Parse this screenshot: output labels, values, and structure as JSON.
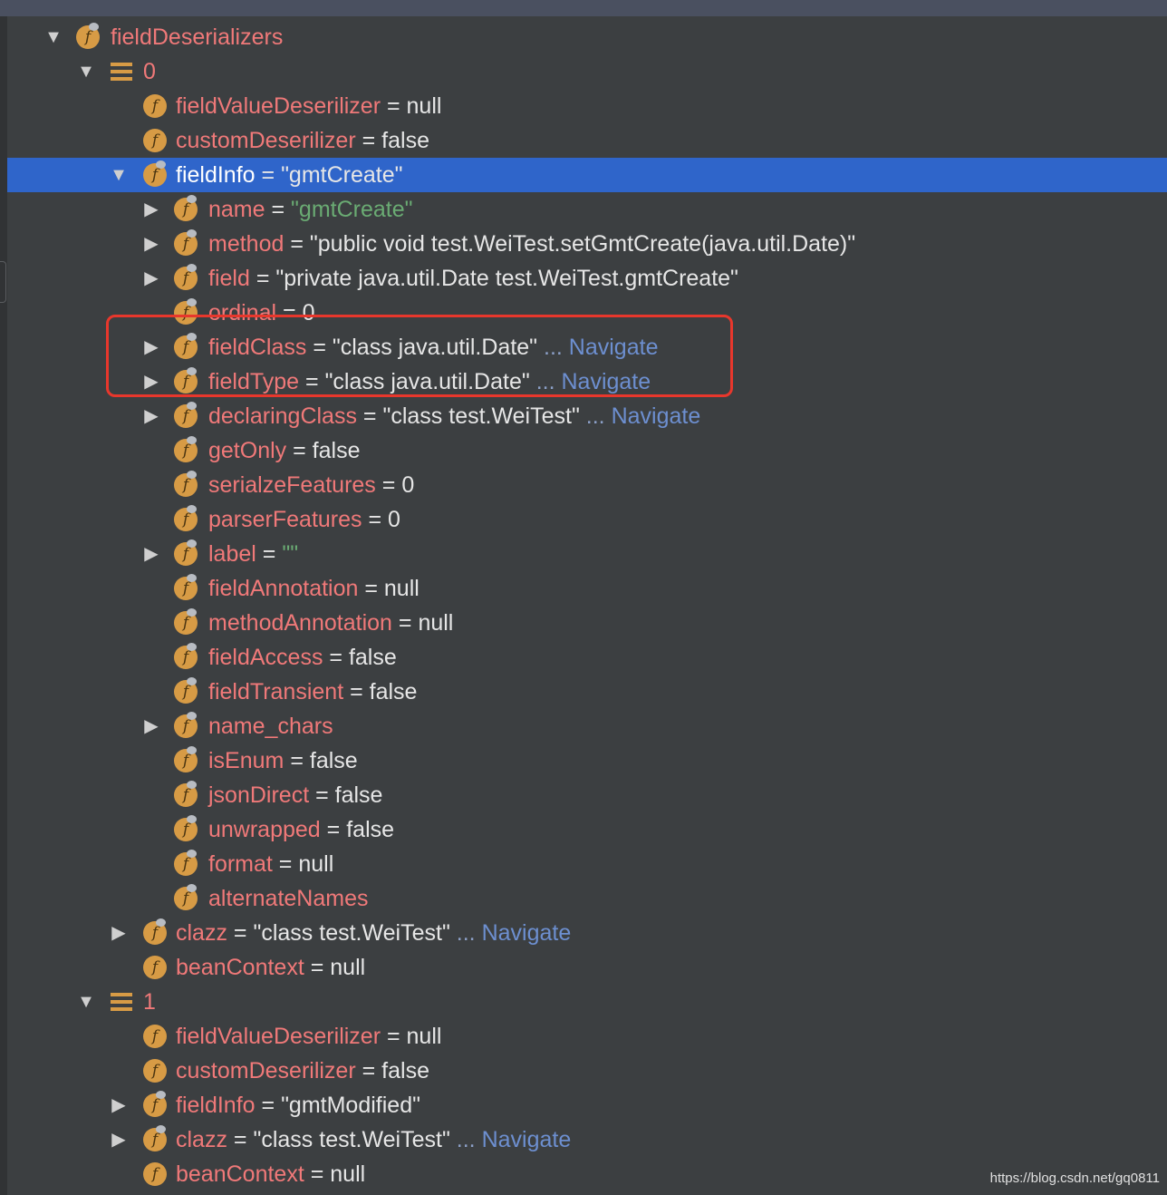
{
  "rows": [
    {
      "depth": 0,
      "arrow": "expanded",
      "icon": "f-lock",
      "name": "fieldDeserializers",
      "eq": "",
      "value": "",
      "vtype": "",
      "navigate": ""
    },
    {
      "depth": 1,
      "arrow": "expanded",
      "icon": "list",
      "name": "0",
      "eq": "",
      "value": "",
      "vtype": "",
      "navigate": ""
    },
    {
      "depth": 2,
      "arrow": "",
      "icon": "f",
      "name": "fieldValueDeserilizer",
      "eq": " = ",
      "value": "null",
      "vtype": "kw",
      "navigate": ""
    },
    {
      "depth": 2,
      "arrow": "",
      "icon": "f",
      "name": "customDeserilizer",
      "eq": " = ",
      "value": "false",
      "vtype": "kw",
      "navigate": ""
    },
    {
      "depth": 2,
      "arrow": "expanded",
      "icon": "f-lock",
      "name": "fieldInfo",
      "eq": " = ",
      "value": "\"gmtCreate\"",
      "vtype": "str",
      "navigate": "",
      "selected": true
    },
    {
      "depth": 3,
      "arrow": "collapsed",
      "icon": "f-lock",
      "name": "name",
      "eq": " = ",
      "value": "\"gmtCreate\"",
      "vtype": "str green",
      "navigate": ""
    },
    {
      "depth": 3,
      "arrow": "collapsed",
      "icon": "f-lock",
      "name": "method",
      "eq": " = ",
      "value": "\"public void test.WeiTest.setGmtCreate(java.util.Date)\"",
      "vtype": "str",
      "navigate": ""
    },
    {
      "depth": 3,
      "arrow": "collapsed",
      "icon": "f-lock",
      "name": "field",
      "eq": " = ",
      "value": "\"private java.util.Date test.WeiTest.gmtCreate\"",
      "vtype": "str",
      "navigate": ""
    },
    {
      "depth": 3,
      "arrow": "",
      "icon": "f-lock",
      "name": "ordinal",
      "eq": " = ",
      "value": "0",
      "vtype": "kw",
      "navigate": ""
    },
    {
      "depth": 3,
      "arrow": "collapsed",
      "icon": "f-lock",
      "name": "fieldClass",
      "eq": " = ",
      "value": "\"class java.util.Date\"",
      "vtype": "str",
      "navigate": "Navigate"
    },
    {
      "depth": 3,
      "arrow": "collapsed",
      "icon": "f-lock",
      "name": "fieldType",
      "eq": " = ",
      "value": "\"class java.util.Date\"",
      "vtype": "str",
      "navigate": "Navigate"
    },
    {
      "depth": 3,
      "arrow": "collapsed",
      "icon": "f-lock",
      "name": "declaringClass",
      "eq": " = ",
      "value": "\"class test.WeiTest\"",
      "vtype": "str",
      "navigate": "Navigate"
    },
    {
      "depth": 3,
      "arrow": "",
      "icon": "f-lock",
      "name": "getOnly",
      "eq": " = ",
      "value": "false",
      "vtype": "kw",
      "navigate": ""
    },
    {
      "depth": 3,
      "arrow": "",
      "icon": "f-lock",
      "name": "serialzeFeatures",
      "eq": " = ",
      "value": "0",
      "vtype": "kw",
      "navigate": ""
    },
    {
      "depth": 3,
      "arrow": "",
      "icon": "f-lock",
      "name": "parserFeatures",
      "eq": " = ",
      "value": "0",
      "vtype": "kw",
      "navigate": ""
    },
    {
      "depth": 3,
      "arrow": "collapsed",
      "icon": "f-lock",
      "name": "label",
      "eq": " = ",
      "value": "\"\"",
      "vtype": "str green",
      "navigate": ""
    },
    {
      "depth": 3,
      "arrow": "",
      "icon": "f-lock",
      "name": "fieldAnnotation",
      "eq": " = ",
      "value": "null",
      "vtype": "kw",
      "navigate": ""
    },
    {
      "depth": 3,
      "arrow": "",
      "icon": "f-lock",
      "name": "methodAnnotation",
      "eq": " = ",
      "value": "null",
      "vtype": "kw",
      "navigate": ""
    },
    {
      "depth": 3,
      "arrow": "",
      "icon": "f-lock",
      "name": "fieldAccess",
      "eq": " = ",
      "value": "false",
      "vtype": "kw",
      "navigate": ""
    },
    {
      "depth": 3,
      "arrow": "",
      "icon": "f-lock",
      "name": "fieldTransient",
      "eq": " = ",
      "value": "false",
      "vtype": "kw",
      "navigate": ""
    },
    {
      "depth": 3,
      "arrow": "collapsed",
      "icon": "f-lock",
      "name": "name_chars",
      "eq": "",
      "value": "",
      "vtype": "",
      "navigate": ""
    },
    {
      "depth": 3,
      "arrow": "",
      "icon": "f-lock",
      "name": "isEnum",
      "eq": " = ",
      "value": "false",
      "vtype": "kw",
      "navigate": ""
    },
    {
      "depth": 3,
      "arrow": "",
      "icon": "f-lock",
      "name": "jsonDirect",
      "eq": " = ",
      "value": "false",
      "vtype": "kw",
      "navigate": ""
    },
    {
      "depth": 3,
      "arrow": "",
      "icon": "f-lock",
      "name": "unwrapped",
      "eq": " = ",
      "value": "false",
      "vtype": "kw",
      "navigate": ""
    },
    {
      "depth": 3,
      "arrow": "",
      "icon": "f-lock",
      "name": "format",
      "eq": " = ",
      "value": "null",
      "vtype": "kw",
      "navigate": ""
    },
    {
      "depth": 3,
      "arrow": "",
      "icon": "f-lock",
      "name": "alternateNames",
      "eq": "",
      "value": "",
      "vtype": "",
      "navigate": ""
    },
    {
      "depth": 2,
      "arrow": "collapsed",
      "icon": "f-lock",
      "name": "clazz",
      "eq": " = ",
      "value": "\"class test.WeiTest\"",
      "vtype": "str",
      "navigate": "Navigate"
    },
    {
      "depth": 2,
      "arrow": "",
      "icon": "f",
      "name": "beanContext",
      "eq": " = ",
      "value": "null",
      "vtype": "kw",
      "navigate": ""
    },
    {
      "depth": 1,
      "arrow": "expanded",
      "icon": "list",
      "name": "1",
      "eq": "",
      "value": "",
      "vtype": "",
      "navigate": ""
    },
    {
      "depth": 2,
      "arrow": "",
      "icon": "f",
      "name": "fieldValueDeserilizer",
      "eq": " = ",
      "value": "null",
      "vtype": "kw",
      "navigate": ""
    },
    {
      "depth": 2,
      "arrow": "",
      "icon": "f",
      "name": "customDeserilizer",
      "eq": " = ",
      "value": "false",
      "vtype": "kw",
      "navigate": ""
    },
    {
      "depth": 2,
      "arrow": "collapsed",
      "icon": "f-lock",
      "name": "fieldInfo",
      "eq": " = ",
      "value": "\"gmtModified\"",
      "vtype": "str",
      "navigate": ""
    },
    {
      "depth": 2,
      "arrow": "collapsed",
      "icon": "f-lock",
      "name": "clazz",
      "eq": " = ",
      "value": "\"class test.WeiTest\"",
      "vtype": "str",
      "navigate": "Navigate"
    },
    {
      "depth": 2,
      "arrow": "",
      "icon": "f",
      "name": "beanContext",
      "eq": " = ",
      "value": "null",
      "vtype": "kw",
      "navigate": ""
    }
  ],
  "ellipsis": "...",
  "watermark": "https://blog.csdn.net/gq0811",
  "colors": {
    "selection": "#2f65ca",
    "field_name": "#f07979",
    "navigate": "#6d8fd0",
    "highlight_box": "#e8372c",
    "icon": "#d79b45"
  }
}
